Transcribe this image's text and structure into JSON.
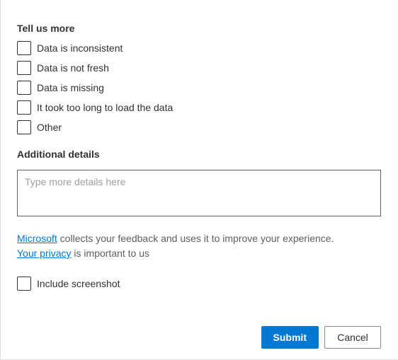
{
  "section_title": "Tell us more",
  "options": {
    "inconsistent": "Data is inconsistent",
    "not_fresh": "Data is not fresh",
    "missing": "Data is missing",
    "too_long": "It took too long to load the data",
    "other": "Other"
  },
  "details": {
    "title": "Additional details",
    "placeholder": "Type more details here"
  },
  "disclaimer": {
    "link1": "Microsoft",
    "text1": " collects your feedback and uses it to improve your experience. ",
    "link2": "Your privacy",
    "text2": " is important to us"
  },
  "screenshot_label": "Include screenshot",
  "buttons": {
    "submit": "Submit",
    "cancel": "Cancel"
  }
}
